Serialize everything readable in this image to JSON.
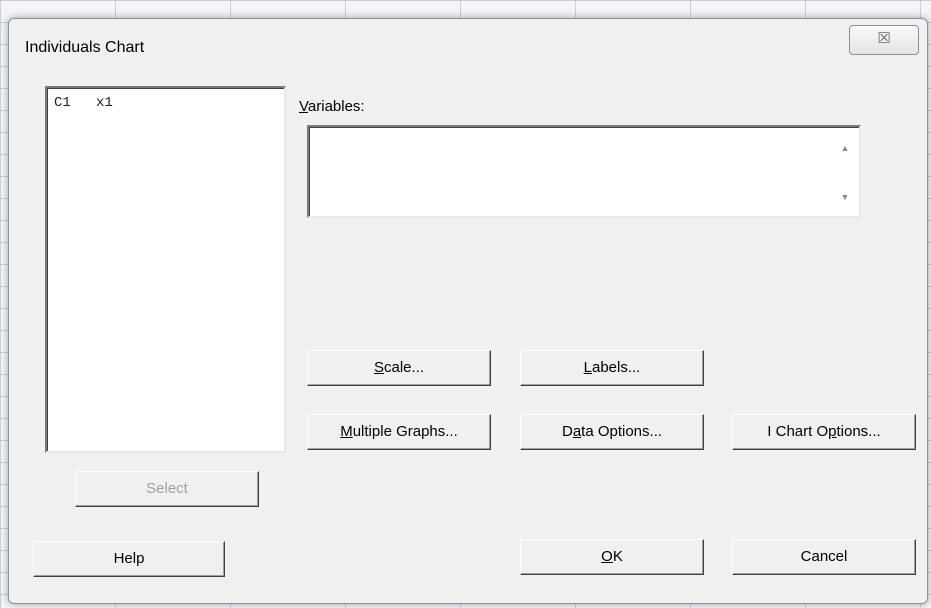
{
  "dialog": {
    "title": "Individuals Chart",
    "close_glyph": "☒"
  },
  "list": {
    "items": [
      {
        "column": "C1",
        "name": "x1"
      }
    ]
  },
  "variables": {
    "label_mnemonic": "V",
    "label_rest": "ariables:",
    "value": ""
  },
  "buttons": {
    "scale": {
      "before": "",
      "mnemonic": "S",
      "after": "cale..."
    },
    "labels": {
      "before": "",
      "mnemonic": "L",
      "after": "abels..."
    },
    "multiple_graphs": {
      "before": "",
      "mnemonic": "M",
      "after": "ultiple Graphs..."
    },
    "data_options": {
      "before": "D",
      "mnemonic": "a",
      "after": "ta Options..."
    },
    "i_chart_options": {
      "before": "I Chart O",
      "mnemonic": "p",
      "after": "tions..."
    },
    "select": "Select",
    "help": "Help",
    "ok": {
      "before": "",
      "mnemonic": "O",
      "after": "K"
    },
    "cancel": "Cancel"
  }
}
